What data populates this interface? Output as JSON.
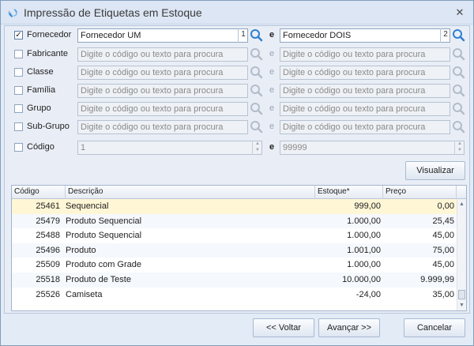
{
  "window": {
    "title": "Impressão de Etiquetas em Estoque",
    "close_glyph": "✕"
  },
  "filters": [
    {
      "label": "Fornecedor",
      "checked": true,
      "from": "Fornecedor UM",
      "from_num": "1",
      "sep": "e",
      "to": "Fornecedor DOIS",
      "to_num": "2"
    },
    {
      "label": "Fabricante",
      "checked": false,
      "from": "Digite o código ou texto para procura",
      "sep": "e",
      "to": "Digite o código ou texto para procura"
    },
    {
      "label": "Classe",
      "checked": false,
      "from": "Digite o código ou texto para procura",
      "sep": "e",
      "to": "Digite o código ou texto para procura"
    },
    {
      "label": "Família",
      "checked": false,
      "from": "Digite o código ou texto para procura",
      "sep": "e",
      "to": "Digite o código ou texto para procura"
    },
    {
      "label": "Grupo",
      "checked": false,
      "from": "Digite o código ou texto para procura",
      "sep": "e",
      "to": "Digite o código ou texto para procura"
    },
    {
      "label": "Sub-Grupo",
      "checked": false,
      "from": "Digite o código ou texto para procura",
      "sep": "e",
      "to": "Digite o código ou texto para procura"
    },
    {
      "label": "Código",
      "checked": false,
      "from": "1",
      "sep": "e",
      "to": "99999"
    }
  ],
  "buttons": {
    "visualizar": "Visualizar",
    "voltar": "<< Voltar",
    "avancar": "Avançar >>",
    "cancelar": "Cancelar"
  },
  "grid": {
    "columns": [
      "Código",
      "Descrição",
      "Estoque*",
      "Preço"
    ],
    "rows": [
      [
        "25461",
        "Sequencial",
        "999,00",
        "0,00"
      ],
      [
        "25479",
        "Produto Sequencial",
        "1.000,00",
        "25,45"
      ],
      [
        "25488",
        "Produto Sequencial",
        "1.000,00",
        "45,00"
      ],
      [
        "25496",
        "Produto",
        "1.001,00",
        "75,00"
      ],
      [
        "25509",
        "Produto com Grade",
        "1.000,00",
        "45,00"
      ],
      [
        "25518",
        "Produto de Teste",
        "10.000,00",
        "9.999,99"
      ],
      [
        "25526",
        "Camiseta",
        "-24,00",
        "35,00"
      ]
    ]
  },
  "colors": {
    "accent": "#3d8fd6",
    "window_bg": "#e3ebf6",
    "selected_row": "#fff6d6"
  }
}
